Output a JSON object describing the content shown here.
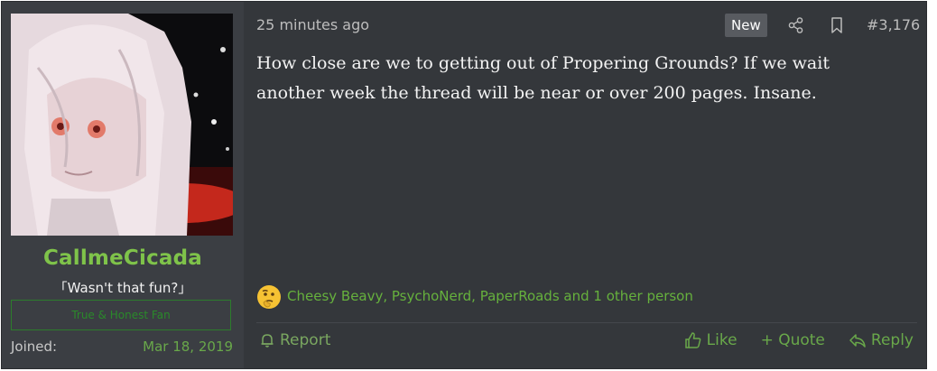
{
  "user": {
    "username": "CallmeCicada",
    "title": "「Wasn't that fun?」",
    "banner": "True & Honest Fan",
    "joined_label": "Joined:",
    "joined_date": "Mar 18, 2019"
  },
  "post": {
    "timestamp": "25 minutes ago",
    "new_badge": "New",
    "post_number": "#3,176",
    "message": "How close are we to getting out of Propering Grounds? If we wait another week the thread will be near or over 200 pages. Insane.",
    "reactions_text": "Cheesy Beavy, PsychoNerd, PaperRoads and 1 other person",
    "reaction_icon": "thinking-emoji"
  },
  "footer": {
    "report": "Report",
    "like": "Like",
    "quote": "+ Quote",
    "reply": "Reply"
  },
  "colors": {
    "background": "#34373b",
    "user_panel": "#3b3e43",
    "username": "#7fc34a",
    "link_green": "#69a84a"
  }
}
